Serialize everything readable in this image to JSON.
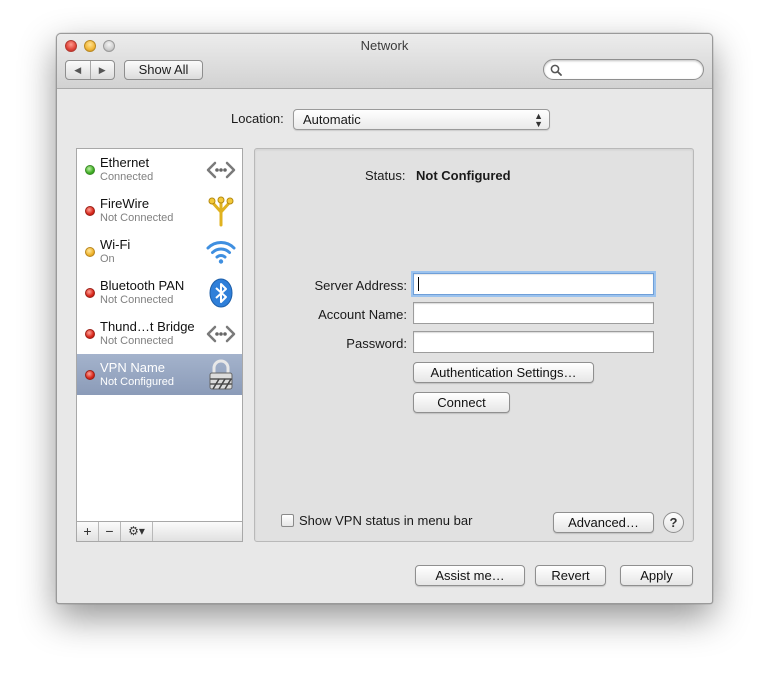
{
  "window": {
    "title": "Network"
  },
  "toolbar": {
    "back_icon": "◀",
    "forward_icon": "▶",
    "show_all_label": "Show All",
    "search_value": "",
    "search_placeholder": ""
  },
  "location": {
    "label": "Location:",
    "value": "Automatic",
    "arrows_icon": "updown-arrows-icon"
  },
  "services": [
    {
      "name": "Ethernet",
      "status": "Connected",
      "status_color": "green",
      "icon": "ethernet-arrows-icon",
      "selected": false
    },
    {
      "name": "FireWire",
      "status": "Not Connected",
      "status_color": "red",
      "icon": "firewire-icon",
      "selected": false
    },
    {
      "name": "Wi-Fi",
      "status": "On",
      "status_color": "yellow",
      "icon": "wifi-icon",
      "selected": false
    },
    {
      "name": "Bluetooth PAN",
      "status": "Not Connected",
      "status_color": "red",
      "icon": "bluetooth-icon",
      "selected": false
    },
    {
      "name": "Thund…t Bridge",
      "status": "Not Connected",
      "status_color": "red",
      "icon": "ethernet-arrows-icon",
      "selected": false
    },
    {
      "name": "VPN Name",
      "status": "Not Configured",
      "status_color": "red",
      "icon": "vpn-lock-icon",
      "selected": true
    }
  ],
  "sidebar_controls": {
    "add": "+",
    "remove": "−",
    "gear": "⚙▾"
  },
  "detail": {
    "status_label": "Status:",
    "status_value": "Not Configured",
    "server_address_label": "Server Address:",
    "server_address_value": "",
    "account_name_label": "Account Name:",
    "account_name_value": "",
    "password_label": "Password:",
    "password_value": "",
    "auth_settings_label": "Authentication Settings…",
    "connect_label": "Connect",
    "show_vpn_status_label": "Show VPN status in menu bar",
    "show_vpn_status_checked": false,
    "advanced_label": "Advanced…",
    "help_label": "?"
  },
  "footer": {
    "assist_label": "Assist me…",
    "revert_label": "Revert",
    "apply_label": "Apply"
  },
  "colors": {
    "selected_row": "#8b9bb8",
    "status_green": "#3fae24",
    "status_red": "#d8261b",
    "status_yellow": "#efb22a",
    "focus_ring": "#9cc3ee"
  }
}
